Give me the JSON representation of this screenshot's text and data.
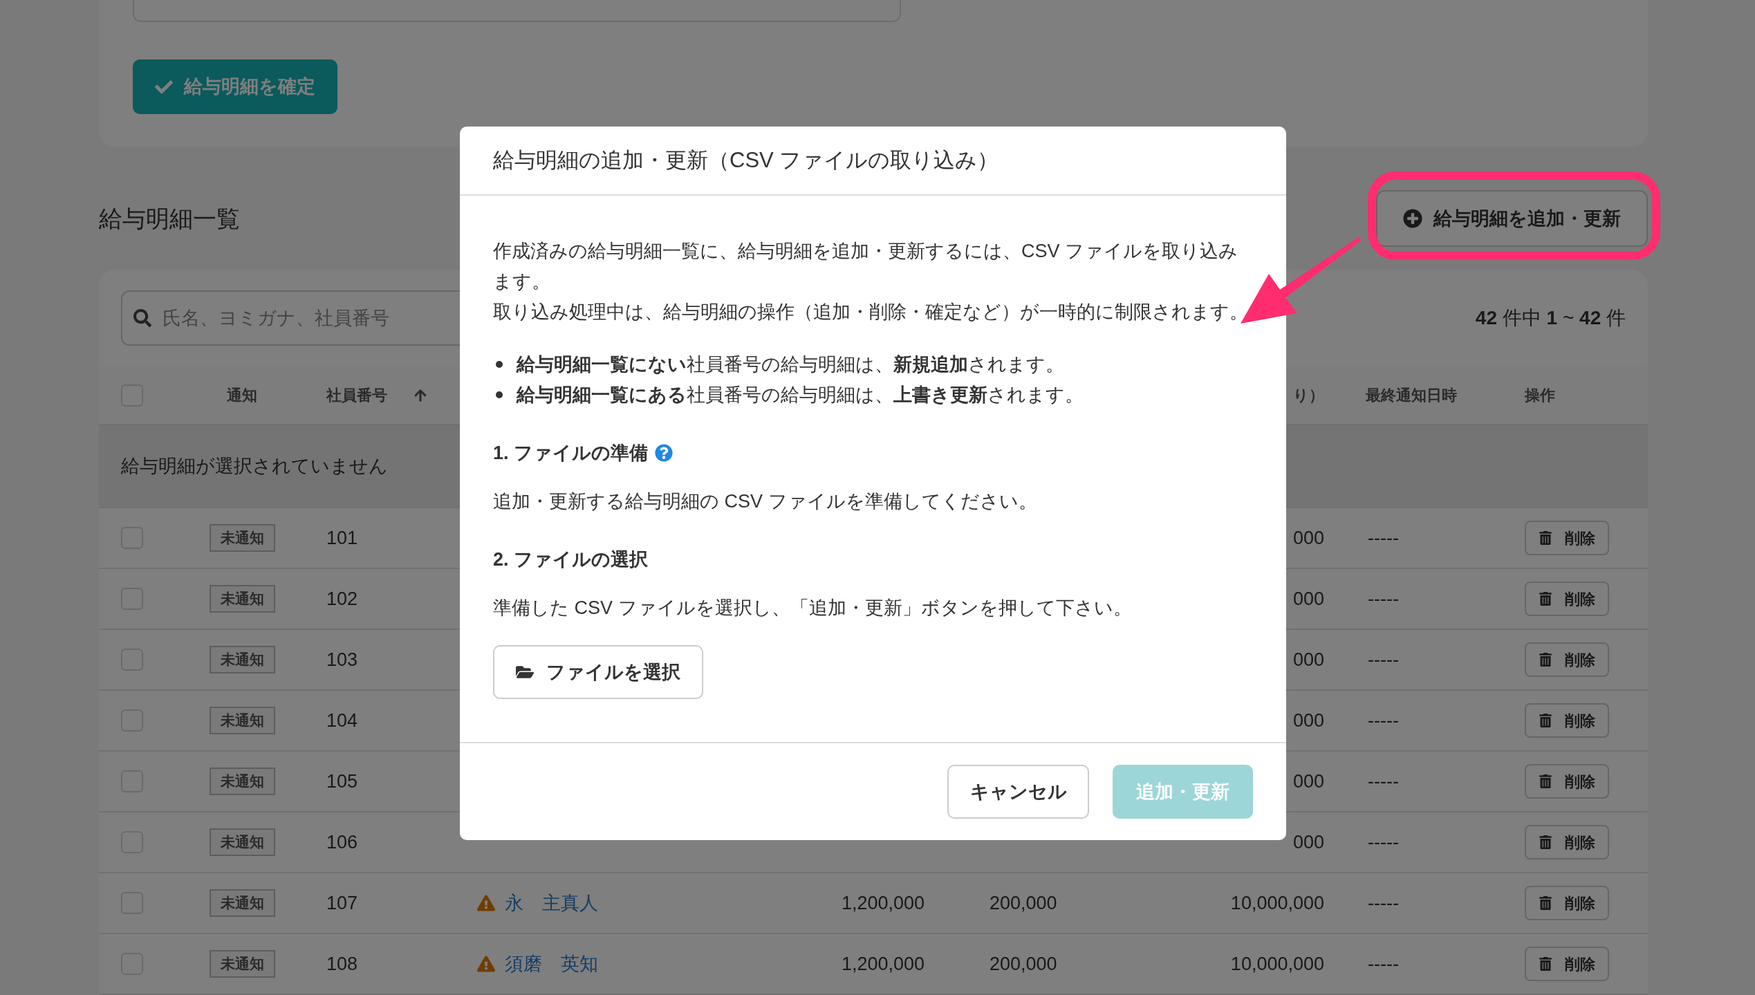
{
  "confirm_button": "給与明細を確定",
  "section_title": "給与明細一覧",
  "add_button": "給与明細を追加・更新",
  "search": {
    "placeholder": "氏名、ヨミガナ、社員番号"
  },
  "count": "**42** 件中 **1** ~ **42** 件",
  "table": {
    "select_all": {
      "checked": false
    },
    "columns": [
      {
        "label": "通知"
      },
      {
        "label": "社員番号",
        "sort_ascending": true
      },
      {
        "label": "り）"
      },
      {
        "label": "最終通知日時"
      },
      {
        "label": "操作"
      }
    ],
    "selection_bar": "給与明細が選択されていません",
    "rows": [
      {
        "checked": false,
        "status": "未通知",
        "number": "101",
        "column_6": "000",
        "last_notified": "-----",
        "action": "削除"
      },
      {
        "checked": false,
        "status": "未通知",
        "number": "102",
        "column_6": "000",
        "last_notified": "-----",
        "action": "削除"
      },
      {
        "checked": false,
        "status": "未通知",
        "number": "103",
        "column_6": "000",
        "last_notified": "-----",
        "action": "削除"
      },
      {
        "checked": false,
        "status": "未通知",
        "number": "104",
        "column_6": "000",
        "last_notified": "-----",
        "action": "削除"
      },
      {
        "checked": false,
        "status": "未通知",
        "number": "105",
        "column_6": "000",
        "last_notified": "-----",
        "action": "削除"
      },
      {
        "checked": false,
        "status": "未通知",
        "number": "106",
        "column_6": "000",
        "last_notified": "-----",
        "action": "削除"
      },
      {
        "checked": false,
        "status": "未通知",
        "number": "107",
        "warning": true,
        "name": "永　主真人",
        "column_4": "1,200,000",
        "column_5": "200,000",
        "column_6": "10,000,000",
        "last_notified": "-----",
        "action": "削除"
      },
      {
        "checked": false,
        "status": "未通知",
        "number": "108",
        "warning": true,
        "name": "須磨　英知",
        "column_4": "1,200,000",
        "column_5": "200,000",
        "column_6": "10,000,000",
        "last_notified": "-----",
        "action": "削除"
      }
    ]
  },
  "dialog": {
    "title": "給与明細の追加・更新（CSV ファイルの取り込み）",
    "intro": [
      "作成済みの給与明細一覧に、給与明細を追加・更新するには、CSV ファイルを取り込みます。",
      "取り込み処理中は、給与明細の操作（追加・削除・確定など）が一時的に制限されます。"
    ],
    "bullets": [
      "**給与明細一覧にない**社員番号の給与明細は、**新規追加**されます。",
      "**給与明細一覧にある**社員番号の給与明細は、**上書き更新**されます。"
    ],
    "steps": [
      {
        "heading": "1. ファイルの準備",
        "help": true,
        "text": "追加・更新する給与明細の CSV ファイルを準備してください。"
      },
      {
        "heading": "2. ファイルの選択",
        "text": "準備した CSV ファイルを選択し、「追加・更新」ボタンを押して下さい。",
        "file_button": "ファイルを選択"
      }
    ],
    "cancel": "キャンセル",
    "submit": {
      "label": "追加・更新",
      "disabled": true
    }
  }
}
